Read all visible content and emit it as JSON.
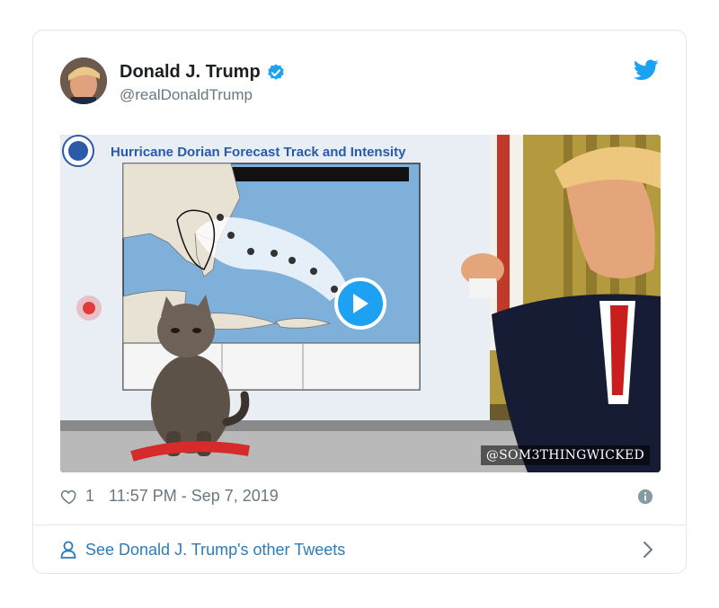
{
  "tweet": {
    "author_name": "Donald J. Trump",
    "author_handle": "@realDonaldTrump",
    "like_count": "1",
    "timestamp": "11:57 PM - Sep 7, 2019"
  },
  "media": {
    "chart_title": "Hurricane Dorian Forecast Track and Intensity",
    "watermark": "@SOM3THINGWICKED"
  },
  "footer": {
    "label": "See Donald J. Trump's other Tweets"
  },
  "colors": {
    "accent": "#1da1f2",
    "link": "#2b7bb9",
    "muted": "#697882"
  },
  "icons": [
    "verified-badge-icon",
    "twitter-bird-icon",
    "play-icon",
    "heart-icon",
    "info-icon",
    "person-icon",
    "chevron-right-icon"
  ]
}
